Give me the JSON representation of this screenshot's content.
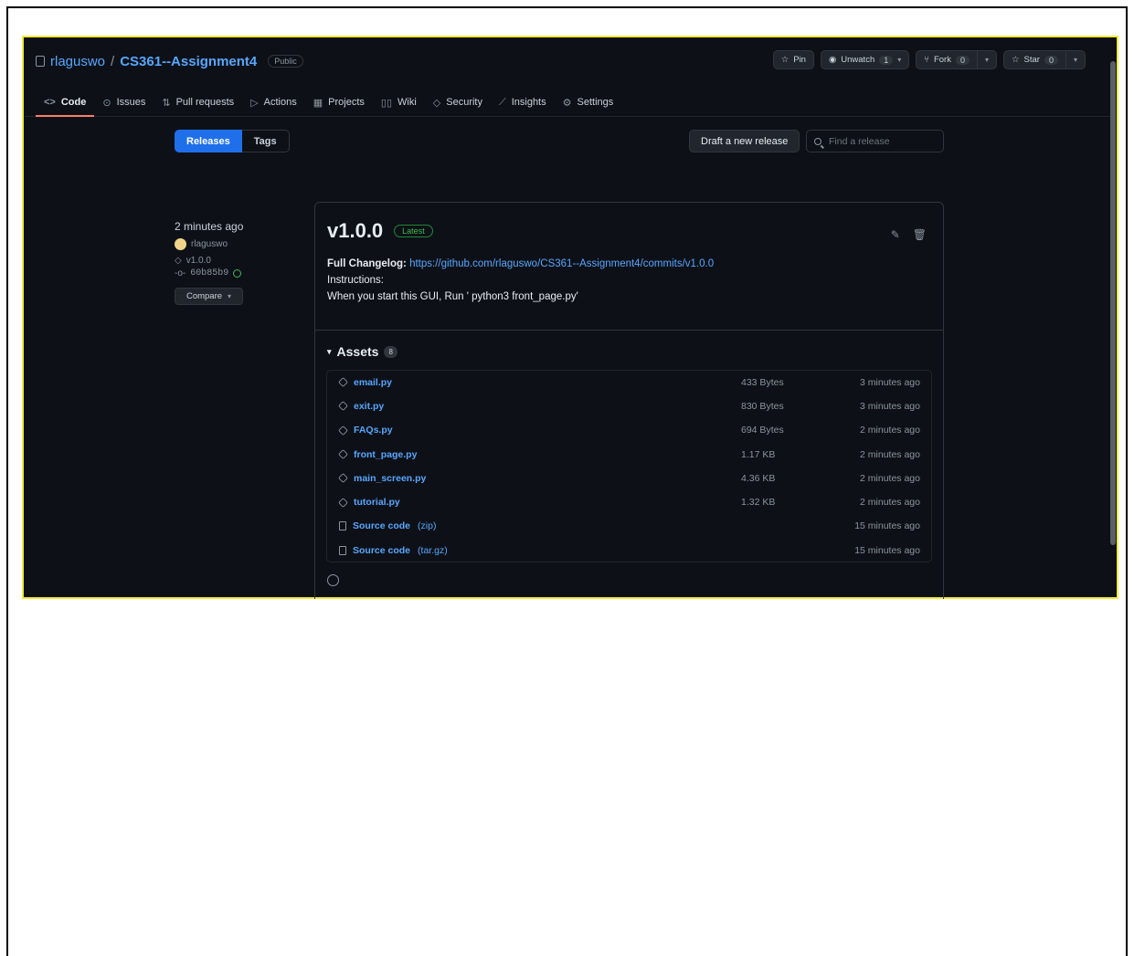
{
  "repo": {
    "owner": "rlaguswo",
    "slash": "/",
    "name": "CS361--Assignment4",
    "visibility": "Public"
  },
  "header_actions": {
    "pin": "Pin",
    "unwatch": "Unwatch",
    "unwatch_count": "1",
    "fork": "Fork",
    "fork_count": "0",
    "star": "Star",
    "star_count": "0"
  },
  "nav": {
    "items": [
      {
        "label": "Code",
        "icon": "code-icon"
      },
      {
        "label": "Issues",
        "icon": "issues-icon"
      },
      {
        "label": "Pull requests",
        "icon": "pull-request-icon"
      },
      {
        "label": "Actions",
        "icon": "actions-icon"
      },
      {
        "label": "Projects",
        "icon": "projects-icon"
      },
      {
        "label": "Wiki",
        "icon": "wiki-icon"
      },
      {
        "label": "Security",
        "icon": "shield-icon"
      },
      {
        "label": "Insights",
        "icon": "graph-icon"
      },
      {
        "label": "Settings",
        "icon": "gear-icon"
      }
    ]
  },
  "release_bar": {
    "tab_releases": "Releases",
    "tab_tags": "Tags",
    "draft_button": "Draft a new release",
    "search_placeholder": "Find a release"
  },
  "release_meta": {
    "time": "2 minutes ago",
    "author": "rlaguswo",
    "tag": "v1.0.0",
    "commit": "60b85b9",
    "compare": "Compare"
  },
  "release": {
    "version": "v1.0.0",
    "badge": "Latest",
    "changelog_label": "Full Changelog:",
    "changelog_url": "https://github.com/rlaguswo/CS361--Assignment4/commits/v1.0.0",
    "instructions_label": "Instructions:",
    "instructions_text": "When you start this GUI, Run ' python3 front_page.py'"
  },
  "assets": {
    "title": "Assets",
    "count": "8",
    "items": [
      {
        "name": "email.py",
        "ext": "",
        "size": "433 Bytes",
        "when": "3 minutes ago",
        "icon": "package-icon"
      },
      {
        "name": "exit.py",
        "ext": "",
        "size": "830 Bytes",
        "when": "3 minutes ago",
        "icon": "package-icon"
      },
      {
        "name": "FAQs.py",
        "ext": "",
        "size": "694 Bytes",
        "when": "2 minutes ago",
        "icon": "package-icon"
      },
      {
        "name": "front_page.py",
        "ext": "",
        "size": "1.17 KB",
        "when": "2 minutes ago",
        "icon": "package-icon"
      },
      {
        "name": "main_screen.py",
        "ext": "",
        "size": "4.36 KB",
        "when": "2 minutes ago",
        "icon": "package-icon"
      },
      {
        "name": "tutorial.py",
        "ext": "",
        "size": "1.32 KB",
        "when": "2 minutes ago",
        "icon": "package-icon"
      },
      {
        "name": "Source code",
        "ext": "(zip)",
        "size": "",
        "when": "15 minutes ago",
        "icon": "zip-icon"
      },
      {
        "name": "Source code",
        "ext": "(tar.gz)",
        "size": "",
        "when": "15 minutes ago",
        "icon": "zip-icon"
      }
    ]
  },
  "colors": {
    "background": "#0d1117",
    "link": "#58a6ff",
    "accent": "#1f6feb",
    "latest": "#3fb950",
    "active_tab_underline": "#f78166",
    "frame_highlight": "#f2ea3a"
  }
}
